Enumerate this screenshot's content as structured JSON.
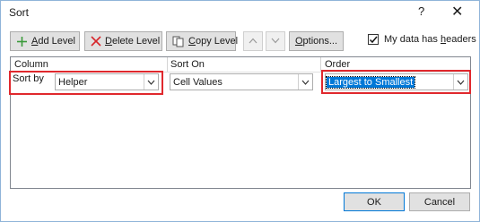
{
  "dialog": {
    "title": "Sort",
    "help_glyph": "?",
    "close_glyph": "✕"
  },
  "toolbar": {
    "add_level": {
      "accel": "A",
      "rest": "dd Level"
    },
    "delete_level": {
      "accel": "D",
      "rest": "elete Level"
    },
    "copy_level": {
      "accel": "C",
      "rest": "opy Level"
    },
    "move_up_glyph": "^",
    "move_down_glyph": "v",
    "options": {
      "accel": "O",
      "rest": "ptions..."
    },
    "headers_check": {
      "pre": "My data has ",
      "accel": "h",
      "post": "eaders",
      "checked": true
    }
  },
  "grid": {
    "headers": {
      "column": "Column",
      "sort_on": "Sort On",
      "order": "Order"
    },
    "row": {
      "label": "Sort by",
      "column_value": "Helper",
      "sort_on_value": "Cell Values",
      "order_value": "Largest to Smallest"
    }
  },
  "footer": {
    "ok": "OK",
    "cancel": "Cancel"
  },
  "colors": {
    "highlight_red": "#e0282d",
    "selection_blue": "#0078d7"
  }
}
